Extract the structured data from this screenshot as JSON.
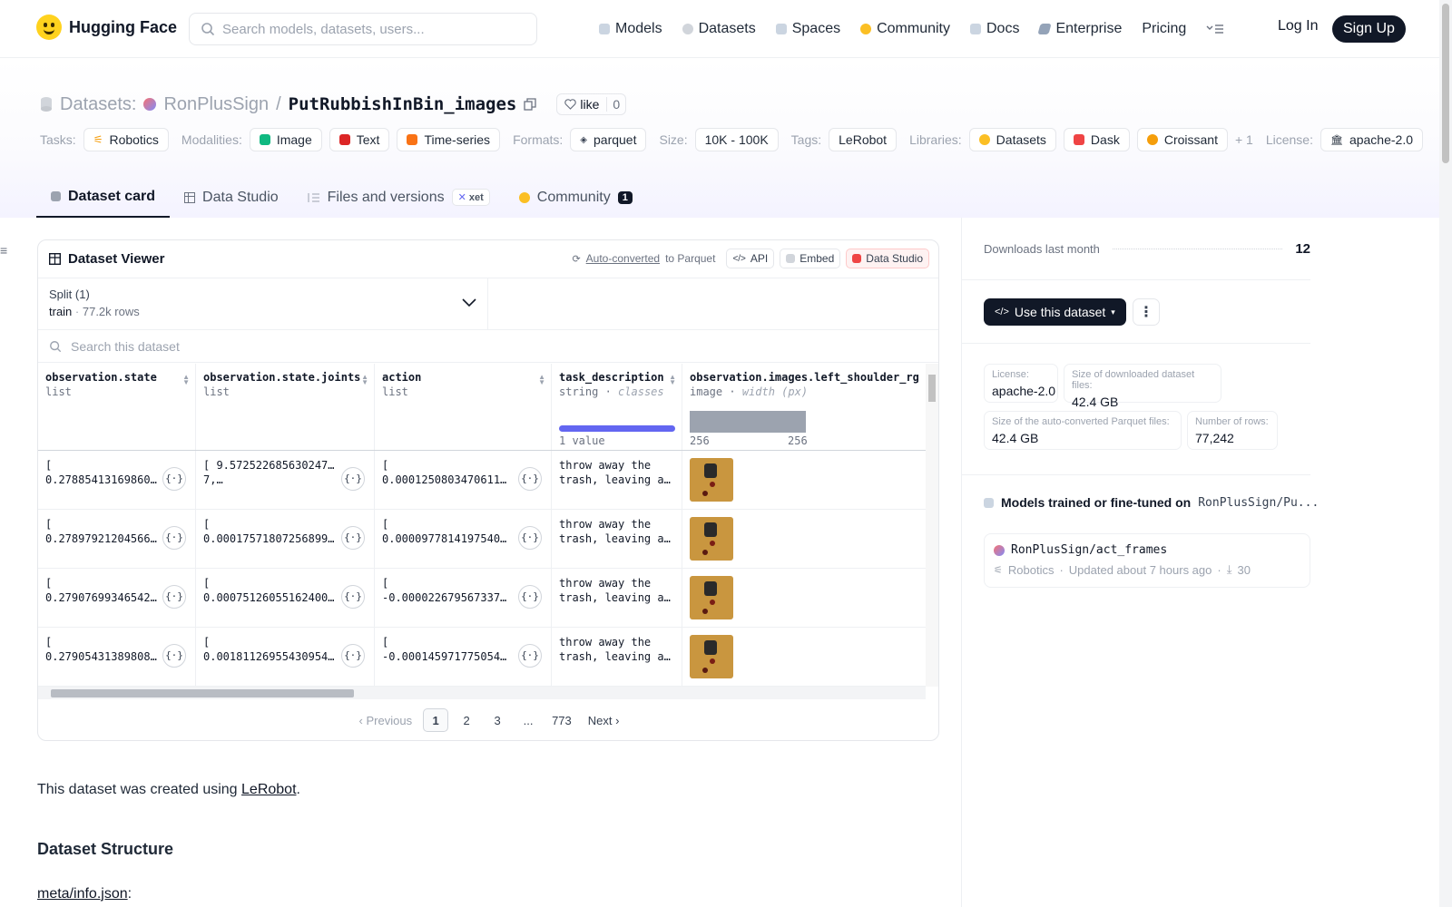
{
  "nav": {
    "brand": "Hugging Face",
    "search_placeholder": "Search models, datasets, users...",
    "links": [
      "Models",
      "Datasets",
      "Spaces",
      "Community",
      "Docs",
      "Enterprise",
      "Pricing"
    ],
    "login": "Log In",
    "signup": "Sign Up"
  },
  "header": {
    "section": "Datasets:",
    "owner": "RonPlusSign",
    "name": "PutRubbishInBin_images",
    "like_label": "like",
    "like_count": "0",
    "tasks_label": "Tasks:",
    "tasks": [
      "Robotics"
    ],
    "modalities_label": "Modalities:",
    "modalities": [
      "Image",
      "Text",
      "Time-series"
    ],
    "formats_label": "Formats:",
    "formats": [
      "parquet"
    ],
    "size_label": "Size:",
    "size": "10K - 100K",
    "tags_label": "Tags:",
    "tags": [
      "LeRobot"
    ],
    "libraries_label": "Libraries:",
    "libraries": [
      "Datasets",
      "Dask",
      "Croissant"
    ],
    "libraries_more": "+ 1",
    "license_label": "License:",
    "license": "apache-2.0"
  },
  "tabs": {
    "card": "Dataset card",
    "studio": "Data Studio",
    "files": "Files and versions",
    "xet": "xet",
    "community": "Community",
    "community_count": "1"
  },
  "viewer": {
    "title": "Dataset Viewer",
    "auto_converted": "Auto-converted",
    "to_parquet": "to Parquet",
    "api": "API",
    "embed": "Embed",
    "data_studio": "Data Studio",
    "split_label": "Split (1)",
    "split_name": "train",
    "split_rows": "77.2k rows",
    "search_placeholder": "Search this dataset",
    "columns": [
      {
        "name": "observation.state",
        "type": "list",
        "extra": ""
      },
      {
        "name": "observation.state.joints",
        "type": "list",
        "extra": ""
      },
      {
        "name": "action",
        "type": "list",
        "extra": ""
      },
      {
        "name": "task_description",
        "type": "string",
        "extra": "classes",
        "note": "1 value"
      },
      {
        "name": "observation.images.left_shoulder_rgb",
        "type": "image",
        "extra": "width (px)",
        "min": "256",
        "max": "256"
      }
    ],
    "rows": [
      [
        "[\n0.27885413169860…",
        "[ 9.572522685630247e-\n7,…",
        "[\n0.00012508034706115…",
        "throw away the\ntrash, leaving an…"
      ],
      [
        "[\n0.27897921204566…",
        "[\n0.0001757180725689977…",
        "[\n0.00009778141975402…",
        "throw away the\ntrash, leaving an…"
      ],
      [
        "[\n0.27907699346542…",
        "[\n0.0007512605516240006…",
        "[\n-0.0000226795673370…",
        "throw away the\ntrash, leaving an…"
      ],
      [
        "[\n0.27905431389808…",
        "[\n0.0018112695543095474…",
        "[\n-0.0001459717750549…",
        "throw away the\ntrash, leaving an…"
      ]
    ],
    "pager": {
      "prev": "Previous",
      "pages": [
        "1",
        "2",
        "3",
        "...",
        "773"
      ],
      "next": "Next"
    }
  },
  "body": {
    "intro_pre": "This dataset was created using ",
    "intro_link": "LeRobot",
    "intro_post": ".",
    "heading": "Dataset Structure",
    "file_link": "meta/info.json",
    "file_post": ":"
  },
  "sidebar": {
    "downloads_label": "Downloads last month",
    "downloads": "12",
    "use_button": "Use this dataset",
    "stats": [
      {
        "label": "License:",
        "value": "apache-2.0"
      },
      {
        "label": "Size of downloaded dataset files:",
        "value": "42.4 GB"
      },
      {
        "label": "Size of the auto-converted Parquet files:",
        "value": "42.4 GB"
      },
      {
        "label": "Number of rows:",
        "value": "77,242"
      }
    ],
    "models_title": "Models trained or fine-tuned on",
    "models_target": "RonPlusSign/Pu...",
    "model_name": "RonPlusSign/act_frames",
    "model_task": "Robotics",
    "model_updated": "Updated about 7 hours ago",
    "model_downloads": "30"
  }
}
